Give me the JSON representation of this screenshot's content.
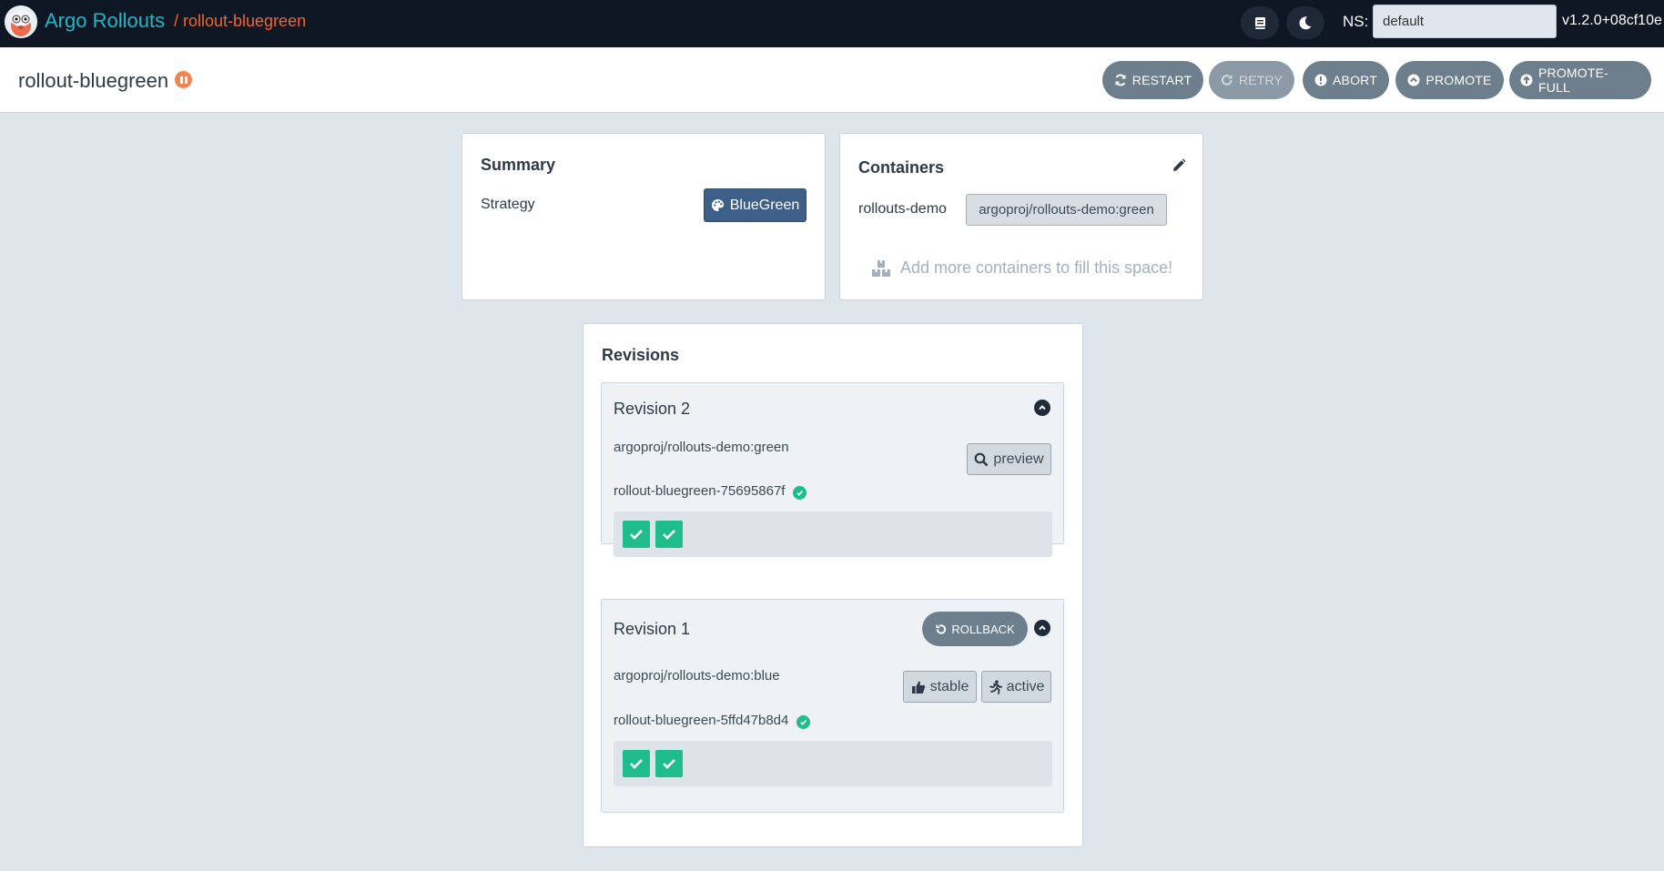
{
  "nav": {
    "brand": "Argo Rollouts",
    "breadcrumb": "/ rollout-bluegreen",
    "ns_label": "NS:",
    "ns_value": "default",
    "version": "v1.2.0+08cf10e"
  },
  "header": {
    "title": "rollout-bluegreen",
    "actions": {
      "restart": "RESTART",
      "retry": "RETRY",
      "abort": "ABORT",
      "promote": "PROMOTE",
      "promote_full": "PROMOTE-FULL"
    }
  },
  "summary": {
    "title": "Summary",
    "strategy_label": "Strategy",
    "strategy_value": "BlueGreen"
  },
  "containers": {
    "title": "Containers",
    "items": [
      {
        "name": "rollouts-demo",
        "image": "argoproj/rollouts-demo:green"
      }
    ],
    "filler_text": "Add more containers to fill this space!"
  },
  "revisions": {
    "title": "Revisions",
    "items": [
      {
        "title": "Revision 2",
        "image": "argoproj/rollouts-demo:green",
        "replicaset": "rollout-bluegreen-75695867f",
        "preview_label": "preview"
      },
      {
        "title": "Revision 1",
        "image": "argoproj/rollouts-demo:blue",
        "replicaset": "rollout-bluegreen-5ffd47b8d4",
        "rollback_label": "ROLLBACK",
        "stable_label": "stable",
        "active_label": "active"
      }
    ]
  },
  "colors": {
    "nav_bg": "#0f1725",
    "brand": "#1fb8c4",
    "breadcrumb": "#f0652f",
    "strategy": "#3e5f88",
    "healthy": "#1fbc8c",
    "paused": "#f4854f"
  }
}
